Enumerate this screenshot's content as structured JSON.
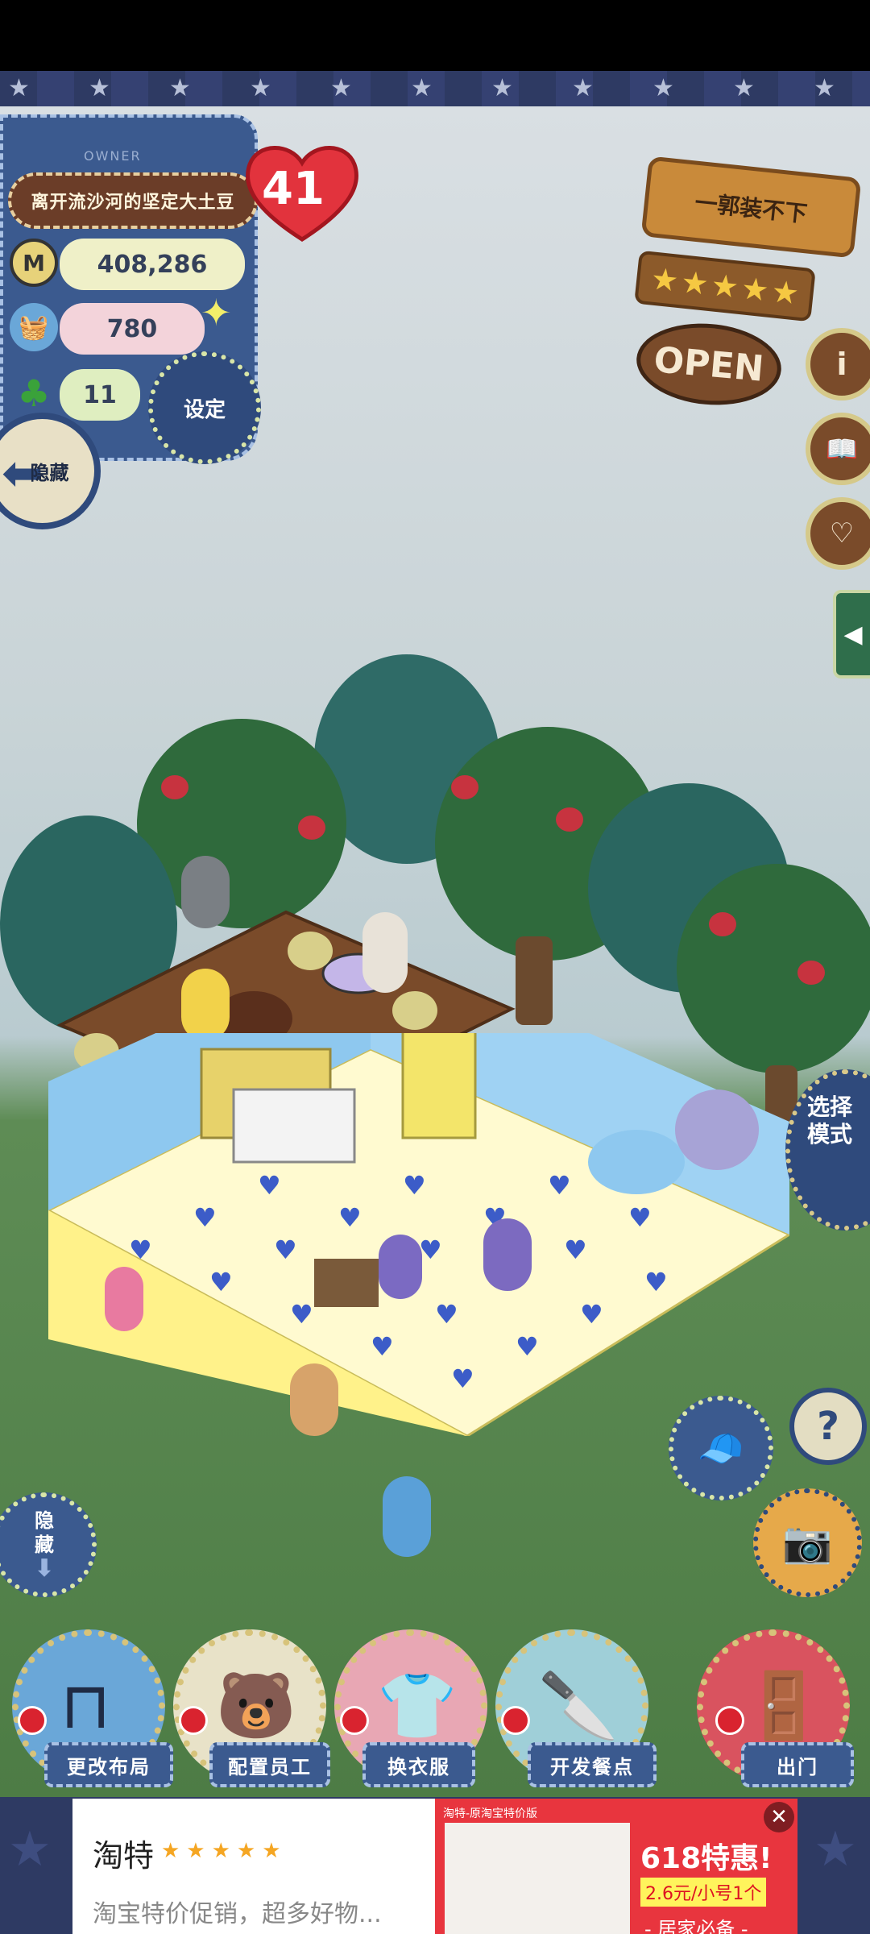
{
  "owner": {
    "tag": "OWNER",
    "name": "离开流沙河的坚定大土豆",
    "level": "41"
  },
  "stats": {
    "money": "408,286",
    "ingredients": "780",
    "clover": "11"
  },
  "buttons": {
    "settings": "设定",
    "hide_top": "隐藏",
    "hide_bottom_line1": "隐",
    "hide_bottom_line2": "藏",
    "select_mode_line1": "选择",
    "select_mode_line2": "模式"
  },
  "shop": {
    "name": "一郭装不下",
    "rating_stars": 5,
    "open_label": "OPEN"
  },
  "actions": [
    {
      "label": "更改布局"
    },
    {
      "label": "配置员工"
    },
    {
      "label": "换衣服"
    },
    {
      "label": "开发餐点"
    },
    {
      "label": "出门"
    }
  ],
  "ad": {
    "title": "淘特",
    "stars": "★★★★★",
    "description": "淘宝特价促销，超多好物...",
    "image_subtitle": "淘特-原淘宝特价版",
    "headline": "618特惠!",
    "price": "2.6元/小号1个",
    "tagline": "- 居家必备 -",
    "close": "✕"
  },
  "colors": {
    "denim": "#3b5a8f",
    "wood": "#7a4b2a",
    "accent_red": "#d9232f",
    "grass": "#4d7c45"
  }
}
